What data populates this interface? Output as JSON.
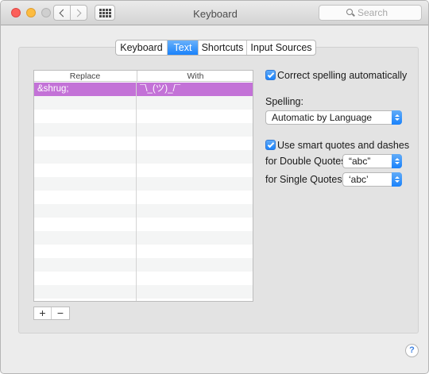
{
  "window": {
    "title": "Keyboard"
  },
  "toolbar": {
    "search_placeholder": "Search"
  },
  "tabs": [
    {
      "label": "Keyboard",
      "selected": false
    },
    {
      "label": "Text",
      "selected": true
    },
    {
      "label": "Shortcuts",
      "selected": false
    },
    {
      "label": "Input Sources",
      "selected": false
    }
  ],
  "table": {
    "columns": [
      "Replace",
      "With"
    ],
    "rows": [
      {
        "replace": "&shrug;",
        "with": "¯\\_(ツ)_/¯",
        "selected": true
      }
    ],
    "add_label": "+",
    "remove_label": "−"
  },
  "settings": {
    "correct_spelling": {
      "label": "Correct spelling automatically",
      "checked": true
    },
    "spelling_label": "Spelling:",
    "spelling_value": "Automatic by Language",
    "smart_quotes": {
      "label": "Use smart quotes and dashes",
      "checked": true
    },
    "double_quotes_label": "for Double Quotes",
    "double_quotes_value": "“abc”",
    "single_quotes_label": "for Single Quotes",
    "single_quotes_value": "‘abc’"
  },
  "help_label": "?",
  "colors": {
    "accent": "#1a82fb",
    "selection": "#c372d7"
  }
}
